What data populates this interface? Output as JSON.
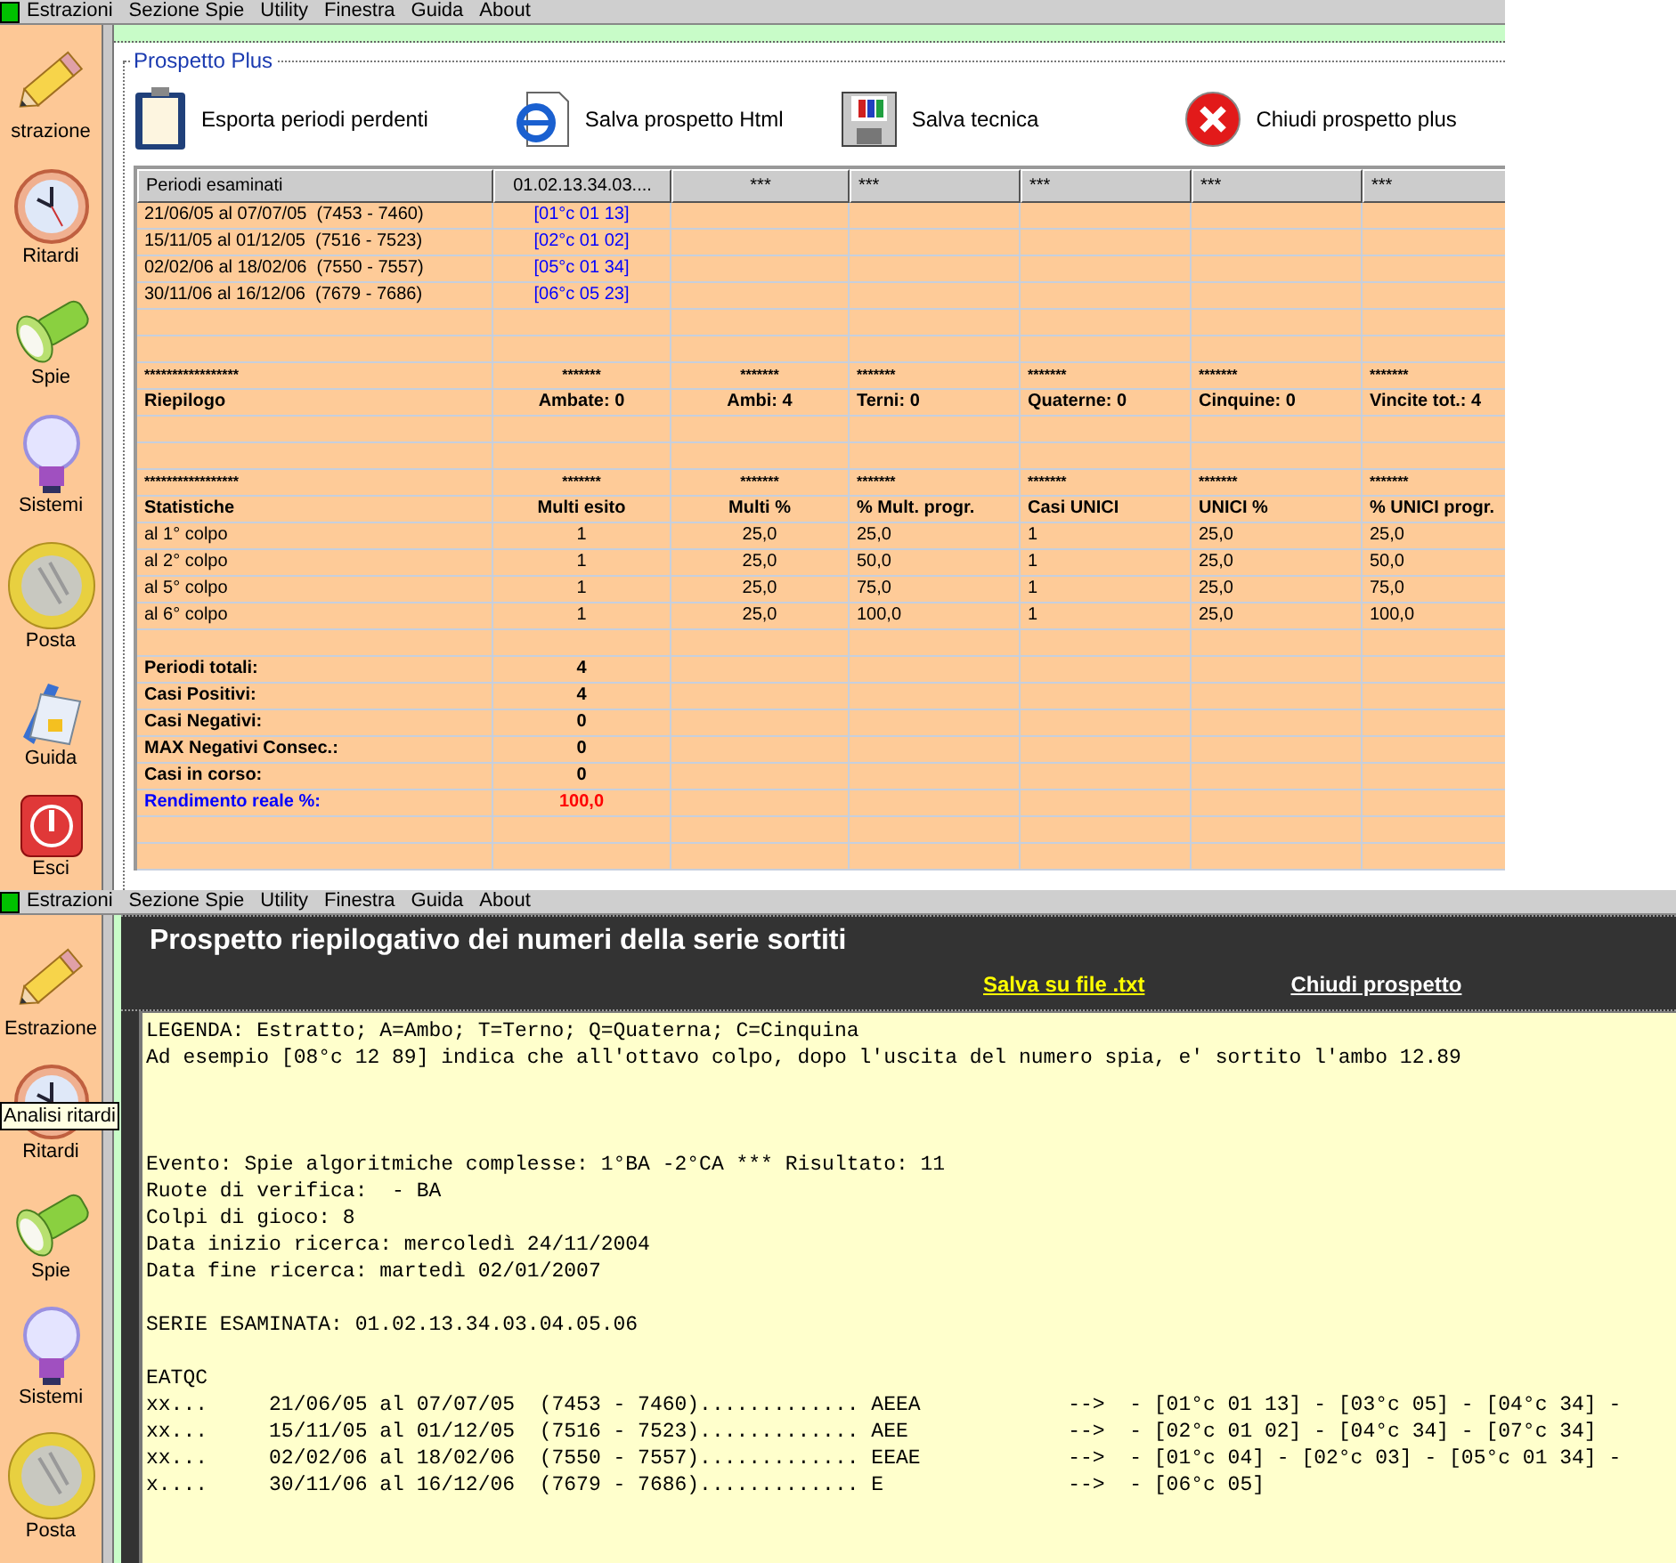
{
  "windows": [
    {
      "kind": "plus",
      "menu": [
        "Estrazioni",
        "Sezione Spie",
        "Utility",
        "Finestra",
        "Guida",
        "About"
      ],
      "sidebar": [
        {
          "label": "strazione"
        },
        {
          "label": "Ritardi"
        },
        {
          "label": "Spie"
        },
        {
          "label": "Sistemi"
        },
        {
          "label": "Posta"
        },
        {
          "label": "Guida"
        },
        {
          "label": "Esci"
        }
      ],
      "panel": {
        "title": "Prospetto Plus",
        "actions": [
          {
            "label": "Esporta periodi perdenti"
          },
          {
            "label": "Salva prospetto Html"
          },
          {
            "label": "Salva tecnica"
          },
          {
            "label": "Chiudi prospetto plus"
          }
        ],
        "table": {
          "columns": [
            "Periodi esaminati",
            "01.02.13.34.03....",
            "***",
            "***",
            "***",
            "***",
            "***"
          ],
          "rows": [
            {
              "kind": "period",
              "cells": [
                "21/06/05 al 07/07/05  (7453 - 7460)",
                "[01°c 01 13]"
              ]
            },
            {
              "kind": "period",
              "cells": [
                "15/11/05 al 01/12/05  (7516 - 7523)",
                "[02°c 01 02]"
              ]
            },
            {
              "kind": "period",
              "cells": [
                "02/02/06 al 18/02/06  (7550 - 7557)",
                "[05°c 01 34]"
              ]
            },
            {
              "kind": "period",
              "cells": [
                "30/11/06 al 16/12/06  (7679 - 7686)",
                "[06°c 05 23]"
              ]
            },
            {
              "kind": "empty"
            },
            {
              "kind": "empty"
            },
            {
              "kind": "stars",
              "cells": [
                "*****************",
                "*******",
                "*******",
                "*******",
                "*******",
                "*******",
                "*******"
              ]
            },
            {
              "kind": "bold",
              "cells": [
                "Riepilogo",
                "Ambate: 0",
                "Ambi: 4",
                "Terni: 0",
                "Quaterne: 0",
                "Cinquine: 0",
                "Vincite tot.: 4"
              ]
            },
            {
              "kind": "empty"
            },
            {
              "kind": "empty"
            },
            {
              "kind": "stars",
              "cells": [
                "*****************",
                "*******",
                "*******",
                "*******",
                "*******",
                "*******",
                "*******"
              ]
            },
            {
              "kind": "bold",
              "cells": [
                "Statistiche",
                "Multi esito",
                "Multi %",
                "% Mult. progr.",
                "Casi UNICI",
                "UNICI %",
                "% UNICI progr."
              ]
            },
            {
              "kind": "plain",
              "cells": [
                "al 1° colpo",
                "1",
                "25,0",
                "25,0",
                "1",
                "25,0",
                "25,0"
              ]
            },
            {
              "kind": "plain",
              "cells": [
                "al 2° colpo",
                "1",
                "25,0",
                "50,0",
                "1",
                "25,0",
                "50,0"
              ]
            },
            {
              "kind": "plain",
              "cells": [
                "al 5° colpo",
                "1",
                "25,0",
                "75,0",
                "1",
                "25,0",
                "75,0"
              ]
            },
            {
              "kind": "plain",
              "cells": [
                "al 6° colpo",
                "1",
                "25,0",
                "100,0",
                "1",
                "25,0",
                "100,0"
              ]
            },
            {
              "kind": "empty"
            },
            {
              "kind": "bold",
              "cells": [
                "Periodi totali:",
                "4"
              ]
            },
            {
              "kind": "bold",
              "cells": [
                "Casi Positivi:",
                "4"
              ]
            },
            {
              "kind": "bold",
              "cells": [
                "Casi Negativi:",
                "0"
              ]
            },
            {
              "kind": "bold",
              "cells": [
                "MAX Negativi Consec.:",
                "0"
              ]
            },
            {
              "kind": "bold",
              "cells": [
                "Casi in corso:",
                "0"
              ]
            },
            {
              "kind": "result",
              "cells": [
                "Rendimento reale %:",
                "100,0"
              ]
            },
            {
              "kind": "empty"
            },
            {
              "kind": "empty"
            }
          ]
        }
      }
    },
    {
      "kind": "report",
      "menu": [
        "Estrazioni",
        "Sezione Spie",
        "Utility",
        "Finestra",
        "Guida",
        "About"
      ],
      "sidebar": [
        {
          "label": "Estrazione"
        },
        {
          "label": "Ritardi"
        },
        {
          "label": "Spie"
        },
        {
          "label": "Sistemi"
        },
        {
          "label": "Posta"
        }
      ],
      "tooltip": "Analisi ritardi",
      "panel": {
        "title": "Prospetto riepilogativo dei numeri della serie sortiti",
        "links": [
          {
            "label": "Salva su file .txt",
            "kind": "primary"
          },
          {
            "label": "Chiudi prospetto",
            "kind": "secondary"
          }
        ],
        "lines": [
          {
            "text": "LEGENDA: Estratto; A=Ambo; T=Terno; Q=Quaterna; C=Cinquina"
          },
          {
            "text": "Ad esempio [08°c 12 89] indica che all'ottavo colpo, dopo l'uscita del numero spia, e' sortito l'ambo 12.89"
          },
          {
            "kind": "blank"
          },
          {
            "kind": "blank"
          },
          {
            "kind": "blank"
          },
          {
            "text": "Evento: Spie algoritmiche complesse: 1°BA -2°CA *** Risultato: 11"
          },
          {
            "text": "Ruote di verifica:  - BA"
          },
          {
            "text": "Colpi di gioco: 8"
          },
          {
            "text": "Data inizio ricerca: mercoledì 24/11/2004"
          },
          {
            "text": "Data fine ricerca: martedì 02/01/2007"
          },
          {
            "kind": "blank"
          },
          {
            "text": "SERIE ESAMINATA: 01.02.13.34.03.04.05.06"
          },
          {
            "kind": "blank"
          },
          {
            "text": "EATQC"
          },
          {
            "text": "xx...     21/06/05 al 07/07/05  (7453 - 7460)............. AEEA            -->  - [01°c 01 13] - [03°c 05] - [04°c 34] -"
          },
          {
            "text": "xx...     15/11/05 al 01/12/05  (7516 - 7523)............. AEE             -->  - [02°c 01 02] - [04°c 34] - [07°c 34]"
          },
          {
            "text": "xx...     02/02/06 al 18/02/06  (7550 - 7557)............. EEAE            -->  - [01°c 04] - [02°c 03] - [05°c 01 34] -"
          },
          {
            "text": "x....     30/11/06 al 16/12/06  (7679 - 7686)............. E               -->  - [06°c 05]"
          }
        ]
      }
    }
  ]
}
